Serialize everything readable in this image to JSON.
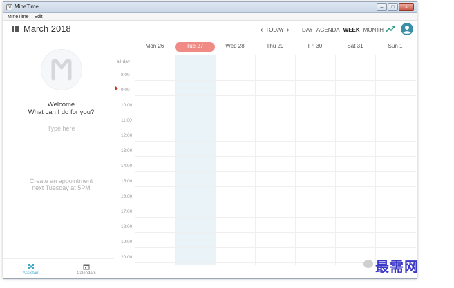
{
  "window": {
    "title": "MineTime",
    "icon_glyph": "M"
  },
  "menu": [
    {
      "label": "MineTime"
    },
    {
      "label": "Edit"
    }
  ],
  "header": {
    "month_title": "March 2018",
    "today_label": "TODAY",
    "views": [
      {
        "label": "DAY",
        "active": false
      },
      {
        "label": "AGENDA",
        "active": false
      },
      {
        "label": "WEEK",
        "active": true
      },
      {
        "label": "MONTH",
        "active": false
      }
    ]
  },
  "assistant": {
    "welcome_title": "Welcome",
    "welcome_prompt": "What can I do for you?",
    "input_placeholder": "Type here",
    "suggestion_line1": "Create an appointment",
    "suggestion_line2": "next Tuesday at 5PM"
  },
  "bottom_tabs": [
    {
      "label": "Assistant",
      "icon": "assistant-icon",
      "active": true
    },
    {
      "label": "Calendars",
      "icon": "calendar-icon",
      "active": false
    }
  ],
  "calendar": {
    "allday_label": "all-day",
    "days": [
      {
        "label": "Mon 26",
        "today": false
      },
      {
        "label": "Tue 27",
        "today": true
      },
      {
        "label": "Wed 28",
        "today": false
      },
      {
        "label": "Thu 29",
        "today": false
      },
      {
        "label": "Fri 30",
        "today": false
      },
      {
        "label": "Sat 31",
        "today": false
      },
      {
        "label": "Sun 1",
        "today": false
      }
    ],
    "hours": [
      "8:00",
      "9:00",
      "10:00",
      "11:00",
      "12:00",
      "13:00",
      "14:00",
      "15:00",
      "16:00",
      "17:00",
      "18:00",
      "19:00",
      "20:00"
    ]
  },
  "watermark": {
    "text": "最需网"
  },
  "colors": {
    "accent": "#3fa7c8",
    "today_badge": "#f08a85",
    "now_line": "#c94b42",
    "avatar": "#3a8fa8",
    "trend": "#2e9a84"
  }
}
